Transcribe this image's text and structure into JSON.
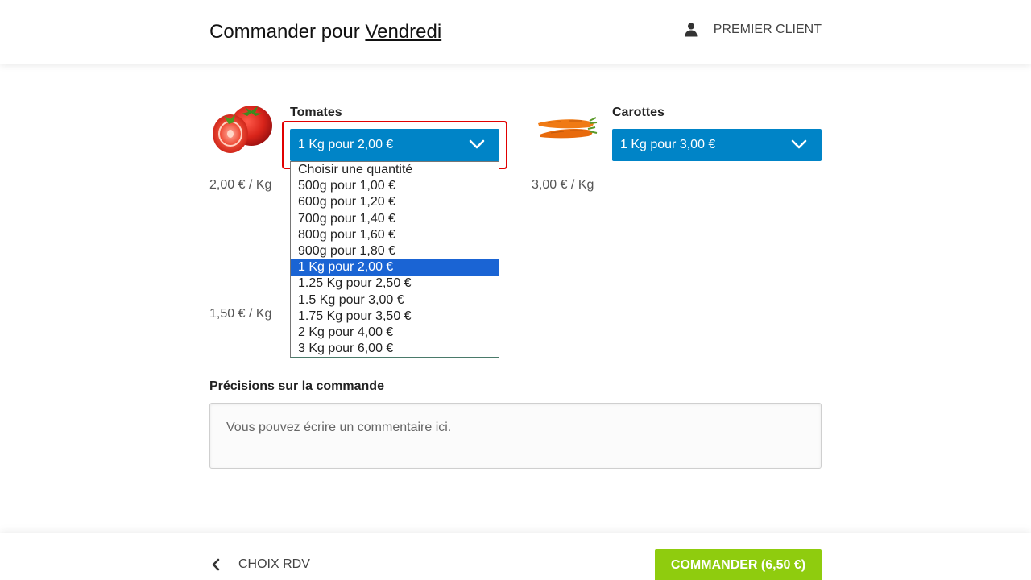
{
  "header": {
    "title_prefix": "Commander pour",
    "day": "Vendredi",
    "user_label": "PREMIER CLIENT"
  },
  "products": [
    {
      "name": "Tomates",
      "selected": "1 Kg pour 2,00 €",
      "price": "2,00 € / Kg"
    },
    {
      "name": "Carottes",
      "selected": "1 Kg pour 3,00 €",
      "price": "3,00 € / Kg"
    },
    {
      "price": "1,50 € / Kg"
    }
  ],
  "dropdown": {
    "options": [
      "Choisir une quantité",
      "500g pour 1,00 €",
      "600g pour 1,20 €",
      "700g pour 1,40 €",
      "800g pour 1,60 €",
      "900g pour 1,80 €",
      "1 Kg pour 2,00 €",
      "1.25 Kg pour 2,50 €",
      "1.5 Kg pour 3,00 €",
      "1.75 Kg pour 3,50 €",
      "2 Kg pour 4,00 €",
      "3 Kg pour 6,00 €"
    ],
    "selected_index": 6
  },
  "comments": {
    "label": "Précisions sur la commande",
    "placeholder": "Vous pouvez écrire un commentaire ici."
  },
  "footer": {
    "back_label": "CHOIX RDV",
    "order_label": "COMMANDER (6,50 €)"
  },
  "colors": {
    "select_bg": "#0084c7",
    "order_btn": "#8fcc0e",
    "focus_ring": "#e10000",
    "highlight": "#1a64d4"
  },
  "icons": [
    "user-icon",
    "chevron-down-icon",
    "chevron-left-icon",
    "tomato-image",
    "carrot-image"
  ]
}
